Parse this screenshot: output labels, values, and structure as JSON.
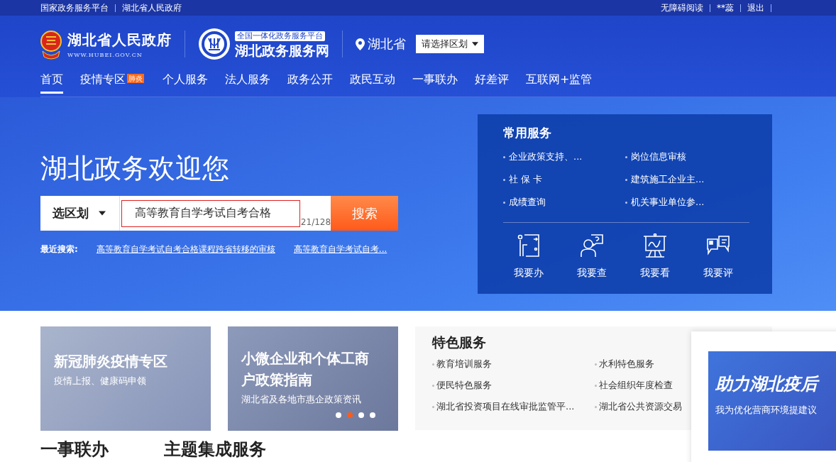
{
  "top_bar": {
    "left_links": [
      "国家政务服务平台",
      "湖北省人民政府"
    ],
    "right_links": [
      "无障碍阅读",
      "**蕊",
      "退出"
    ]
  },
  "header": {
    "gov_logo": {
      "title": "湖北省人民政府",
      "url": "WWW.HUBEI.GOV.CN"
    },
    "service_logo": {
      "tag": "全国一体化政务服务平台",
      "title": "湖北政务服务网"
    },
    "location": "湖北省",
    "region_select": "请选择区划"
  },
  "nav": [
    {
      "label": "首页",
      "selected": true
    },
    {
      "label": "疫情专区",
      "badge": "肺炎",
      "selected": false
    },
    {
      "label": "个人服务",
      "selected": false
    },
    {
      "label": "法人服务",
      "selected": false
    },
    {
      "label": "政务公开",
      "selected": false
    },
    {
      "label": "政民互动",
      "selected": false
    },
    {
      "label": "一事联办",
      "selected": false
    },
    {
      "label": "好差评",
      "selected": false
    },
    {
      "label": "互联网+监管",
      "selected": false
    }
  ],
  "hero": {
    "title": "湖北政务欢迎您",
    "search": {
      "region": "选区划",
      "value": "高等教育自学考试自考合格",
      "counter": "21/128",
      "button": "搜索"
    },
    "recent": {
      "label": "最近搜索:",
      "links": [
        "高等教育自学考试自考合格课程跨省转移的审核",
        "高等教育自学考试自考..."
      ]
    }
  },
  "common_services": {
    "title": "常用服务",
    "items": [
      "企业政策支持、...",
      "岗位信息审核",
      "社 保 卡",
      "建筑施工企业主...",
      "成绩查询",
      "机关事业单位参..."
    ],
    "actions": [
      {
        "kind": "do",
        "label": "我要办"
      },
      {
        "kind": "ask",
        "label": "我要查"
      },
      {
        "kind": "view",
        "label": "我要看"
      },
      {
        "kind": "rate",
        "label": "我要评"
      }
    ]
  },
  "feature_cards": [
    {
      "title": "新冠肺炎疫情专区",
      "subtitle": "疫情上报、健康码申领"
    },
    {
      "title": "小微企业和个体工商户政策指南",
      "subtitle": "湖北省及各地市惠企政策资讯",
      "dots": [
        {
          "selected": false
        },
        {
          "selected": true
        },
        {
          "selected": false
        },
        {
          "selected": false
        }
      ]
    }
  ],
  "special_services": {
    "title": "特色服务",
    "items": [
      "教育培训服务",
      "水利特色服务",
      "便民特色服务",
      "社会组织年度检查",
      "湖北省投资项目在线审批监管平...",
      "湖北省公共资源交易"
    ]
  },
  "popup": {
    "title": "助力湖北疫后",
    "subtitle": "我为优化营商环境提建议"
  },
  "section_headings": [
    "一事联办",
    "主题集成服务"
  ]
}
